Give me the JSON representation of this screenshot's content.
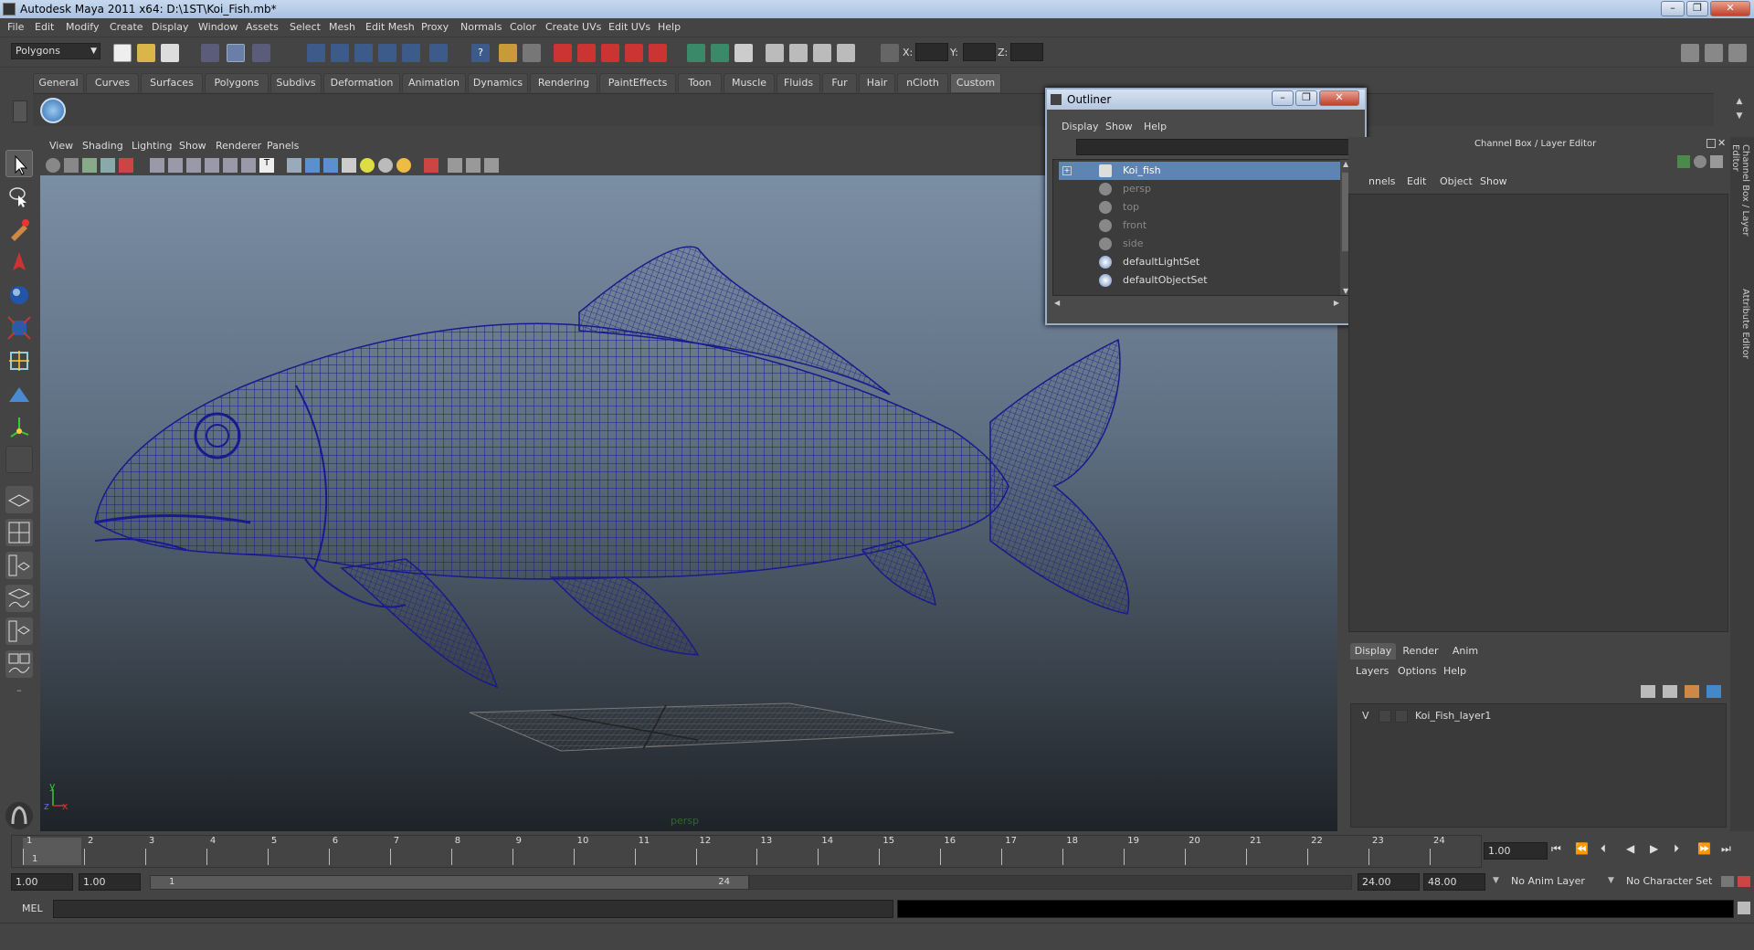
{
  "window": {
    "title": "Autodesk Maya 2011 x64: D:\\1ST\\Koi_Fish.mb*"
  },
  "menubar": [
    "File",
    "Edit",
    "Modify",
    "Create",
    "Display",
    "Window",
    "Assets",
    "Select",
    "Mesh",
    "Edit Mesh",
    "Proxy",
    "Normals",
    "Color",
    "Create UVs",
    "Edit UVs",
    "Help"
  ],
  "statusline": {
    "mode": "Polygons",
    "x_label": "X:",
    "y_label": "Y:",
    "z_label": "Z:"
  },
  "shelf_tabs": [
    "General",
    "Curves",
    "Surfaces",
    "Polygons",
    "Subdivs",
    "Deformation",
    "Animation",
    "Dynamics",
    "Rendering",
    "PaintEffects",
    "Toon",
    "Muscle",
    "Fluids",
    "Fur",
    "Hair",
    "nCloth",
    "Custom"
  ],
  "shelf_active": "Custom",
  "panel_menu": [
    "View",
    "Shading",
    "Lighting",
    "Show",
    "Renderer",
    "Panels"
  ],
  "viewport": {
    "camera_label": "persp",
    "axis_y": "y",
    "axis_x": "x",
    "axis_z": "z"
  },
  "outliner": {
    "title": "Outliner",
    "menu": [
      "Display",
      "Show",
      "Help"
    ],
    "items": [
      {
        "label": "Koi_fish",
        "selected": true,
        "dim": false
      },
      {
        "label": "persp",
        "selected": false,
        "dim": true
      },
      {
        "label": "top",
        "selected": false,
        "dim": true
      },
      {
        "label": "front",
        "selected": false,
        "dim": true
      },
      {
        "label": "side",
        "selected": false,
        "dim": true
      },
      {
        "label": "defaultLightSet",
        "selected": false,
        "dim": false
      },
      {
        "label": "defaultObjectSet",
        "selected": false,
        "dim": false
      }
    ]
  },
  "channel_box": {
    "title": "Channel Box / Layer Editor",
    "menu": [
      "nnels",
      "Edit",
      "Object",
      "Show"
    ]
  },
  "layer_editor": {
    "tabs": [
      "Display",
      "Render",
      "Anim"
    ],
    "active_tab": "Display",
    "menu": [
      "Layers",
      "Options",
      "Help"
    ],
    "layer": {
      "visible": "V",
      "name": "Koi_Fish_layer1"
    }
  },
  "side_tabs": [
    "Channel Box / Layer Editor",
    "Attribute Editor"
  ],
  "timeslider": {
    "ticks": [
      "1",
      "2",
      "3",
      "4",
      "5",
      "6",
      "7",
      "8",
      "9",
      "10",
      "11",
      "12",
      "13",
      "14",
      "15",
      "16",
      "17",
      "18",
      "19",
      "20",
      "21",
      "22",
      "23",
      "24"
    ],
    "current_frame": "1",
    "current_time_field": "1.00"
  },
  "range": {
    "start_time": "1.00",
    "playback_start": "1.00",
    "range_start_label": "1",
    "range_end_label": "24",
    "playback_end": "24.00",
    "end_time": "48.00",
    "anim_layer": "No Anim Layer",
    "character_set": "No Character Set"
  },
  "cmdline": {
    "label": "MEL"
  },
  "colors": {
    "wire": "#1a1a8c",
    "selected_row": "#5e84b4",
    "viewport_top": "#7a8ea4",
    "viewport_bottom": "#1e2328"
  }
}
